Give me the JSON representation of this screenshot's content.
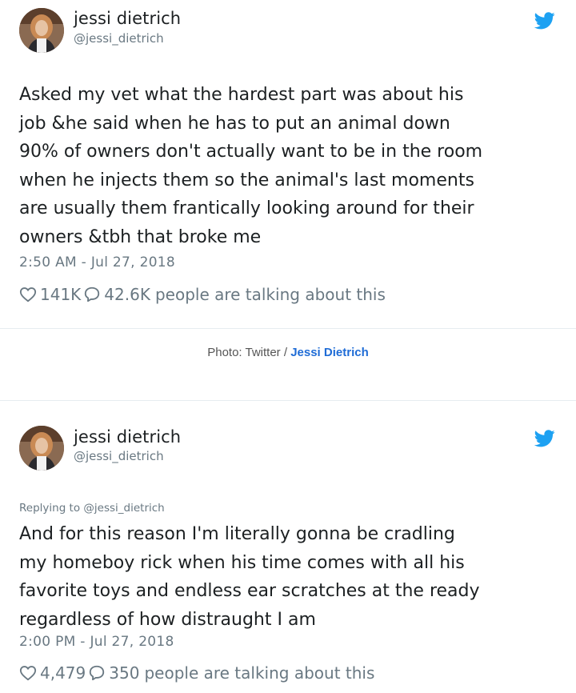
{
  "tweets": [
    {
      "display_name": "jessi dietrich",
      "handle": "@jessi_dietrich",
      "text": "Asked my vet what the hardest part was about his\njob &he said when he has to put an animal down\n90% of owners don't actually want to be in the room\nwhen he injects them so the animal's last moments\nare usually them frantically looking around for their\nowners &tbh that broke me",
      "timestamp": "2:50 AM - Jul 27, 2018",
      "likes": "141K",
      "replies": "42.6K",
      "talking_label": "people are talking about this",
      "avatar_icon": "user-avatar",
      "brand_icon": "twitter-bird-icon"
    },
    {
      "display_name": "jessi dietrich",
      "handle": "@jessi_dietrich",
      "replying_to": "Replying to @jessi_dietrich",
      "text": "And for this reason I'm literally gonna be cradling\nmy homeboy rick when his time comes with all his\nfavorite toys and endless ear scratches at the ready\nregardless of how distraught I am",
      "timestamp": "2:00 PM - Jul 27, 2018",
      "likes": "4,479",
      "replies": "350",
      "talking_label": "people are talking about this",
      "avatar_icon": "user-avatar",
      "brand_icon": "twitter-bird-icon"
    }
  ],
  "photo_credit": {
    "prefix": "Photo: Twitter / ",
    "source": "Jessi Dietrich"
  },
  "colors": {
    "text": "#1c2022",
    "muted": "#697882",
    "twitter_blue": "#1da1f2",
    "credit_link": "#1f6cd6",
    "divider": "#e6ecf0"
  }
}
